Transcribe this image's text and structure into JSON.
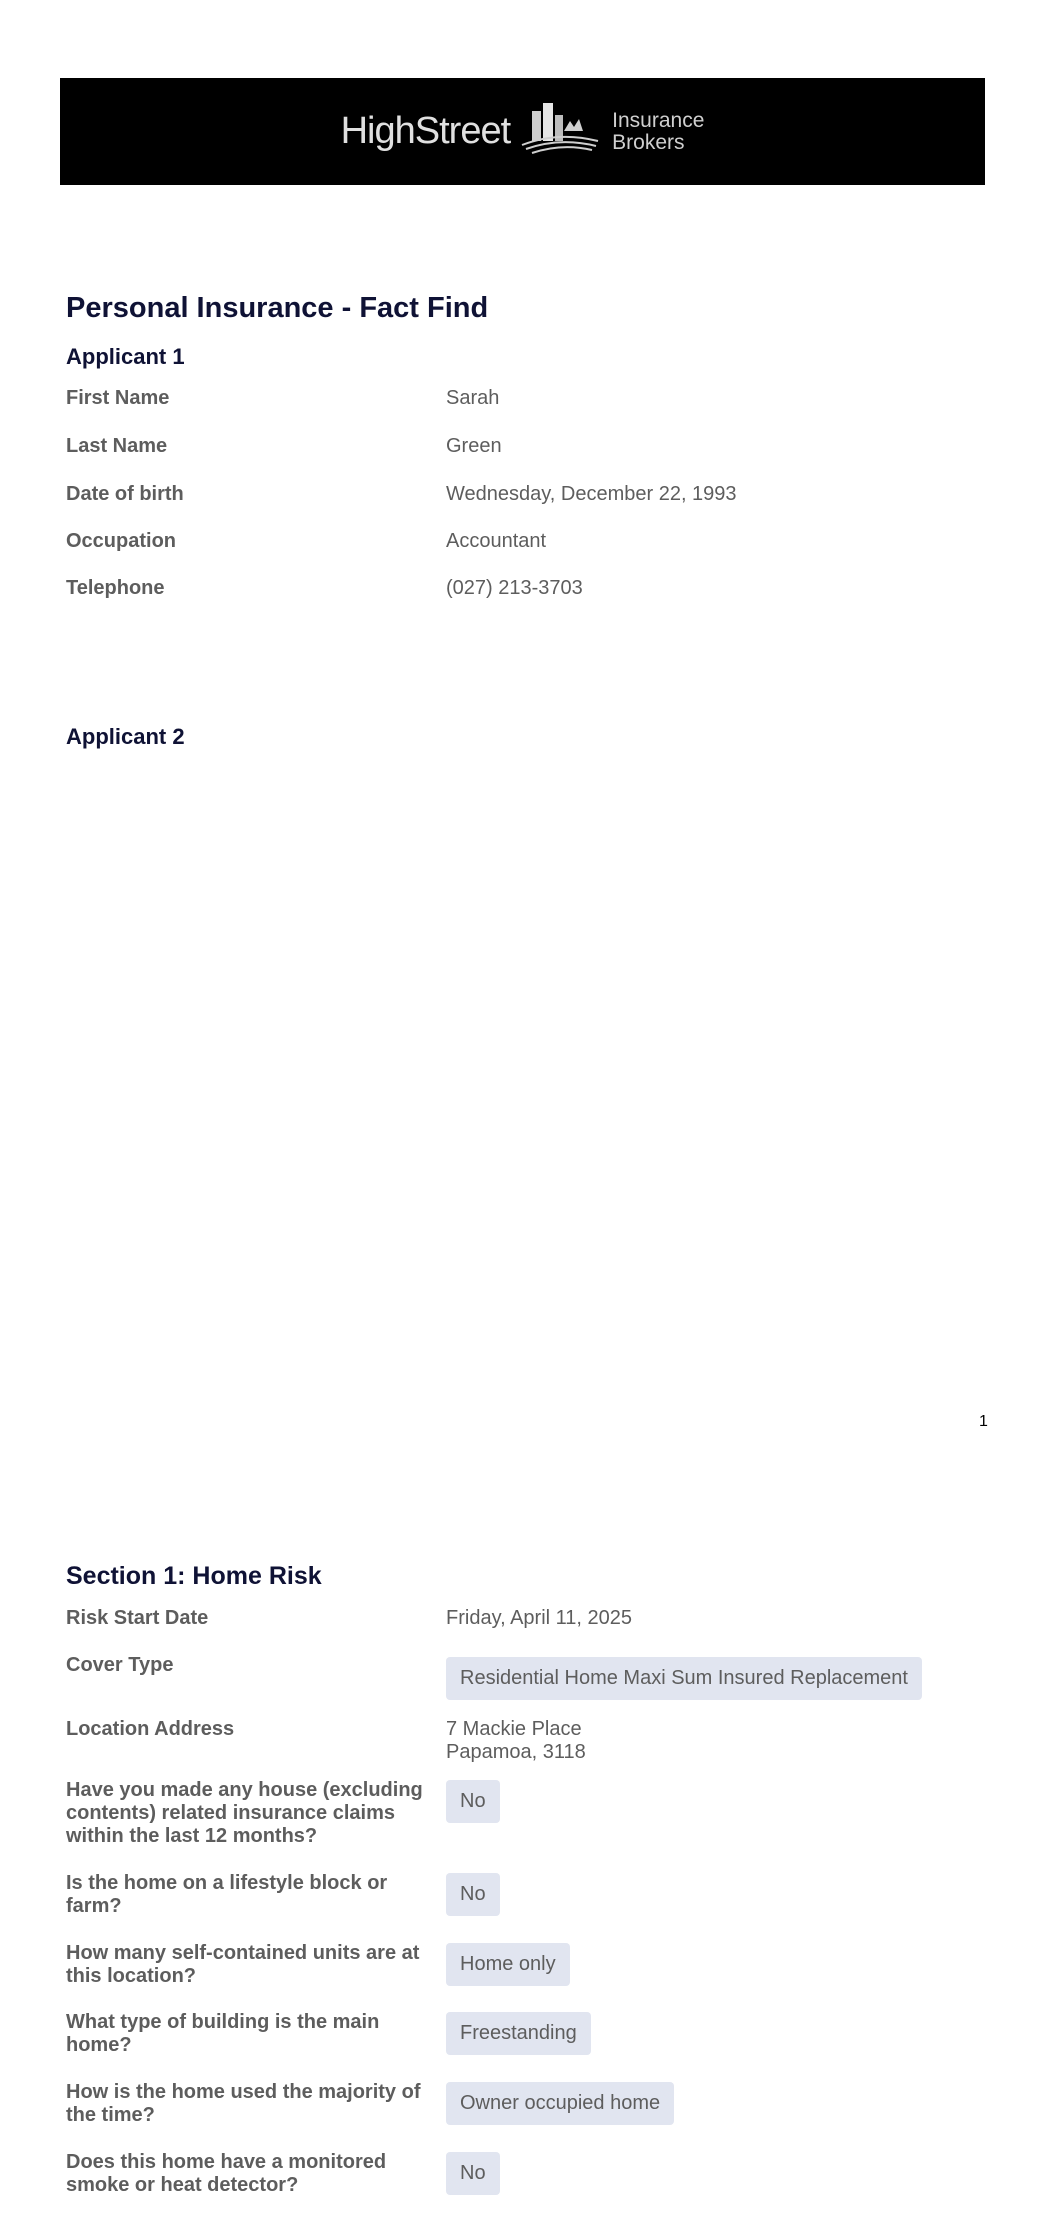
{
  "header": {
    "logo_main": "HighStreet",
    "logo_sub_line1": "Insurance",
    "logo_sub_line2": "Brokers",
    "banner_color": "#000000"
  },
  "title": "Personal Insurance - Fact Find",
  "applicant1": {
    "heading": "Applicant 1",
    "fields": [
      {
        "label": "First Name",
        "value": "Sarah"
      },
      {
        "label": "Last Name",
        "value": "Green"
      },
      {
        "label": "Date of birth",
        "value": "Wednesday, December 22, 1993"
      },
      {
        "label": "Occupation",
        "value": "Accountant"
      },
      {
        "label": "Telephone",
        "value": "(027) 213-3703"
      }
    ]
  },
  "applicant2": {
    "heading": "Applicant 2"
  },
  "page_number": "1",
  "section1": {
    "heading": "Section 1: Home Risk",
    "risk_start_label": "Risk Start Date",
    "risk_start_value": "Friday, April 11, 2025",
    "cover_type_label": "Cover Type",
    "cover_type_value": "Residential Home Maxi Sum Insured Replacement",
    "location_label": "Location Address",
    "location_line1": "7 Mackie Place",
    "location_line2": "Papamoa, 3118",
    "claims_label_line1": "Have you made any house (excluding",
    "claims_label_line2": "contents) related insurance claims",
    "claims_label_line3": "within the last 12 months?",
    "claims_value": "No",
    "lifestyle_label_line1": "Is the home on a lifestyle block or",
    "lifestyle_label_line2": "farm?",
    "lifestyle_value": "No",
    "units_label_line1": "How many self-contained units are at",
    "units_label_line2": "this location?",
    "units_value": "Home only",
    "building_label_line1": "What type of building is the main",
    "building_label_line2": "home?",
    "building_value": "Freestanding",
    "usage_label_line1": "How is the home used the majority of",
    "usage_label_line2": "the time?",
    "usage_value": "Owner occupied home",
    "smoke_label_line1": "Does this home have a monitored",
    "smoke_label_line2": "smoke or heat detector?",
    "smoke_value": "No"
  },
  "colors": {
    "heading": "#0f1235",
    "text": "#5d5d5d",
    "pill_bg": "#e1e5f0"
  }
}
